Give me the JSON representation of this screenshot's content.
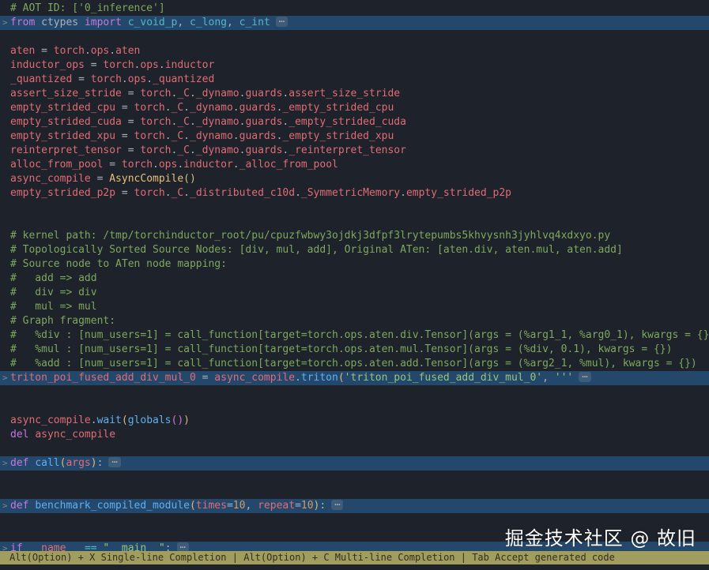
{
  "colors": {
    "bg": "#1e222a",
    "fg": "#abb2bf",
    "comment": "#7ea85f",
    "red": "#e06c75",
    "purple": "#c678dd",
    "blue": "#61afef",
    "yellow": "#e5c07b",
    "orange": "#d19a66",
    "cyan": "#56b6c2",
    "green": "#98c379",
    "gold": "#d7ba7d",
    "pink": "#d670d6",
    "gutter": "#7d8590",
    "line_highlight": "#24486b",
    "statusbar_bg": "#a09d5e",
    "statusbar_fg": "#312f1d"
  },
  "editor": {
    "fold_icon": ">",
    "fold_placeholder": "⋯",
    "lines": [
      {
        "t": [
          [
            "# AOT ID: ['0_inference']",
            "comment"
          ]
        ]
      },
      {
        "hl": true,
        "fold": true,
        "ell": true,
        "t": [
          [
            "from",
            "purple"
          ],
          [
            " ctypes ",
            "fg"
          ],
          [
            "import",
            "purple"
          ],
          [
            " ",
            "fg"
          ],
          [
            "c_void_p",
            "cyan"
          ],
          [
            ", ",
            "fg"
          ],
          [
            "c_long",
            "cyan"
          ],
          [
            ", ",
            "fg"
          ],
          [
            "c_int",
            "cyan"
          ]
        ]
      },
      {
        "t": []
      },
      {
        "t": [
          [
            "aten",
            "red"
          ],
          [
            " = ",
            "fg"
          ],
          [
            "torch",
            "red"
          ],
          [
            ".",
            "fg"
          ],
          [
            "ops",
            "red"
          ],
          [
            ".",
            "fg"
          ],
          [
            "aten",
            "red"
          ]
        ]
      },
      {
        "t": [
          [
            "inductor_ops",
            "red"
          ],
          [
            " = ",
            "fg"
          ],
          [
            "torch",
            "red"
          ],
          [
            ".",
            "fg"
          ],
          [
            "ops",
            "red"
          ],
          [
            ".",
            "fg"
          ],
          [
            "inductor",
            "red"
          ]
        ]
      },
      {
        "t": [
          [
            "_quantized",
            "red"
          ],
          [
            " = ",
            "fg"
          ],
          [
            "torch",
            "red"
          ],
          [
            ".",
            "fg"
          ],
          [
            "ops",
            "red"
          ],
          [
            ".",
            "fg"
          ],
          [
            "_quantized",
            "red"
          ]
        ]
      },
      {
        "t": [
          [
            "assert_size_stride",
            "red"
          ],
          [
            " = ",
            "fg"
          ],
          [
            "torch",
            "red"
          ],
          [
            ".",
            "fg"
          ],
          [
            "_C",
            "red"
          ],
          [
            ".",
            "fg"
          ],
          [
            "_dynamo",
            "red"
          ],
          [
            ".",
            "fg"
          ],
          [
            "guards",
            "red"
          ],
          [
            ".",
            "fg"
          ],
          [
            "assert_size_stride",
            "red"
          ]
        ]
      },
      {
        "t": [
          [
            "empty_strided_cpu",
            "red"
          ],
          [
            " = ",
            "fg"
          ],
          [
            "torch",
            "red"
          ],
          [
            ".",
            "fg"
          ],
          [
            "_C",
            "red"
          ],
          [
            ".",
            "fg"
          ],
          [
            "_dynamo",
            "red"
          ],
          [
            ".",
            "fg"
          ],
          [
            "guards",
            "red"
          ],
          [
            ".",
            "fg"
          ],
          [
            "_empty_strided_cpu",
            "red"
          ]
        ]
      },
      {
        "t": [
          [
            "empty_strided_cuda",
            "red"
          ],
          [
            " = ",
            "fg"
          ],
          [
            "torch",
            "red"
          ],
          [
            ".",
            "fg"
          ],
          [
            "_C",
            "red"
          ],
          [
            ".",
            "fg"
          ],
          [
            "_dynamo",
            "red"
          ],
          [
            ".",
            "fg"
          ],
          [
            "guards",
            "red"
          ],
          [
            ".",
            "fg"
          ],
          [
            "_empty_strided_cuda",
            "red"
          ]
        ]
      },
      {
        "t": [
          [
            "empty_strided_xpu",
            "red"
          ],
          [
            " = ",
            "fg"
          ],
          [
            "torch",
            "red"
          ],
          [
            ".",
            "fg"
          ],
          [
            "_C",
            "red"
          ],
          [
            ".",
            "fg"
          ],
          [
            "_dynamo",
            "red"
          ],
          [
            ".",
            "fg"
          ],
          [
            "guards",
            "red"
          ],
          [
            ".",
            "fg"
          ],
          [
            "_empty_strided_xpu",
            "red"
          ]
        ]
      },
      {
        "t": [
          [
            "reinterpret_tensor",
            "red"
          ],
          [
            " = ",
            "fg"
          ],
          [
            "torch",
            "red"
          ],
          [
            ".",
            "fg"
          ],
          [
            "_C",
            "red"
          ],
          [
            ".",
            "fg"
          ],
          [
            "_dynamo",
            "red"
          ],
          [
            ".",
            "fg"
          ],
          [
            "guards",
            "red"
          ],
          [
            ".",
            "fg"
          ],
          [
            "_reinterpret_tensor",
            "red"
          ]
        ]
      },
      {
        "t": [
          [
            "alloc_from_pool",
            "red"
          ],
          [
            " = ",
            "fg"
          ],
          [
            "torch",
            "red"
          ],
          [
            ".",
            "fg"
          ],
          [
            "ops",
            "red"
          ],
          [
            ".",
            "fg"
          ],
          [
            "inductor",
            "red"
          ],
          [
            ".",
            "fg"
          ],
          [
            "_alloc_from_pool",
            "red"
          ]
        ]
      },
      {
        "t": [
          [
            "async_compile",
            "red"
          ],
          [
            " = ",
            "fg"
          ],
          [
            "AsyncCompile",
            "yellow"
          ],
          [
            "()",
            "gold"
          ]
        ]
      },
      {
        "t": [
          [
            "empty_strided_p2p",
            "red"
          ],
          [
            " = ",
            "fg"
          ],
          [
            "torch",
            "red"
          ],
          [
            ".",
            "fg"
          ],
          [
            "_C",
            "red"
          ],
          [
            ".",
            "fg"
          ],
          [
            "_distributed_c10d",
            "red"
          ],
          [
            ".",
            "fg"
          ],
          [
            "_SymmetricMemory",
            "red"
          ],
          [
            ".",
            "fg"
          ],
          [
            "empty_strided_p2p",
            "red"
          ]
        ]
      },
      {
        "t": []
      },
      {
        "t": []
      },
      {
        "t": [
          [
            "# kernel path: /tmp/torchinductor_root/pu/cpuzfwbwy3ojdkj3dfpf3lrytepumbs5khvysnh3jyhlvq4xdxyo.py",
            "comment"
          ]
        ]
      },
      {
        "t": [
          [
            "# Topologically Sorted Source Nodes: [div, mul, add], Original ATen: [aten.div, aten.mul, aten.add]",
            "comment"
          ]
        ]
      },
      {
        "t": [
          [
            "# Source node to ATen node mapping:",
            "comment"
          ]
        ]
      },
      {
        "t": [
          [
            "#   add => add",
            "comment"
          ]
        ]
      },
      {
        "t": [
          [
            "#   div => div",
            "comment"
          ]
        ]
      },
      {
        "t": [
          [
            "#   mul => mul",
            "comment"
          ]
        ]
      },
      {
        "t": [
          [
            "# Graph fragment:",
            "comment"
          ]
        ]
      },
      {
        "t": [
          [
            "#   %div : [num_users=1] = call_function[target=torch.ops.aten.div.Tensor](args = (%arg1_1, %arg0_1), kwargs = {})",
            "comment"
          ]
        ]
      },
      {
        "t": [
          [
            "#   %mul : [num_users=1] = call_function[target=torch.ops.aten.mul.Tensor](args = (%div, 0.1), kwargs = {})",
            "comment"
          ]
        ]
      },
      {
        "t": [
          [
            "#   %add : [num_users=1] = call_function[target=torch.ops.aten.add.Tensor](args = (%arg2_1, %mul), kwargs = {})",
            "comment"
          ]
        ]
      },
      {
        "hl": true,
        "fold": true,
        "ell": true,
        "t": [
          [
            "triton_poi_fused_add_div_mul_0",
            "red"
          ],
          [
            " = ",
            "fg"
          ],
          [
            "async_compile",
            "red"
          ],
          [
            ".",
            "fg"
          ],
          [
            "triton",
            "blue"
          ],
          [
            "(",
            "gold"
          ],
          [
            "'triton_poi_fused_add_div_mul_0'",
            "green"
          ],
          [
            ", ",
            "fg"
          ],
          [
            "'''",
            "green"
          ]
        ]
      },
      {
        "t": []
      },
      {
        "t": []
      },
      {
        "t": [
          [
            "async_compile",
            "red"
          ],
          [
            ".",
            "fg"
          ],
          [
            "wait",
            "blue"
          ],
          [
            "(",
            "gold"
          ],
          [
            "globals",
            "blue"
          ],
          [
            "()",
            "pink"
          ],
          [
            ")",
            "gold"
          ]
        ]
      },
      {
        "t": [
          [
            "del",
            "purple"
          ],
          [
            " ",
            "fg"
          ],
          [
            "async_compile",
            "red"
          ]
        ]
      },
      {
        "t": []
      },
      {
        "hl": true,
        "fold": true,
        "ell": true,
        "t": [
          [
            "def",
            "purple"
          ],
          [
            " ",
            "fg"
          ],
          [
            "call",
            "blue"
          ],
          [
            "(",
            "gold"
          ],
          [
            "args",
            "red"
          ],
          [
            ")",
            "gold"
          ],
          [
            ":",
            "fg"
          ]
        ]
      },
      {
        "t": []
      },
      {
        "t": []
      },
      {
        "hl": true,
        "fold": true,
        "ell": true,
        "t": [
          [
            "def",
            "purple"
          ],
          [
            " ",
            "fg"
          ],
          [
            "benchmark_compiled_module",
            "blue"
          ],
          [
            "(",
            "gold"
          ],
          [
            "times",
            "red"
          ],
          [
            "=",
            "fg"
          ],
          [
            "10",
            "orange"
          ],
          [
            ", ",
            "fg"
          ],
          [
            "repeat",
            "red"
          ],
          [
            "=",
            "fg"
          ],
          [
            "10",
            "orange"
          ],
          [
            ")",
            "gold"
          ],
          [
            ":",
            "fg"
          ]
        ]
      },
      {
        "t": []
      },
      {
        "t": []
      },
      {
        "hl": true,
        "fold": true,
        "ell": true,
        "t": [
          [
            "if",
            "purple"
          ],
          [
            " ",
            "fg"
          ],
          [
            "__name__",
            "red"
          ],
          [
            " ",
            "fg"
          ],
          [
            "==",
            "cyan"
          ],
          [
            " ",
            "fg"
          ],
          [
            "\"__main__\"",
            "green"
          ],
          [
            ":",
            "fg"
          ]
        ]
      }
    ]
  },
  "status_bar": {
    "text": "Alt(Option) + X Single-line Completion | Alt(Option) + C Multi-line Completion | Tab Accept generated code"
  },
  "watermark": {
    "text": "掘金技术社区 @ 故旧"
  }
}
